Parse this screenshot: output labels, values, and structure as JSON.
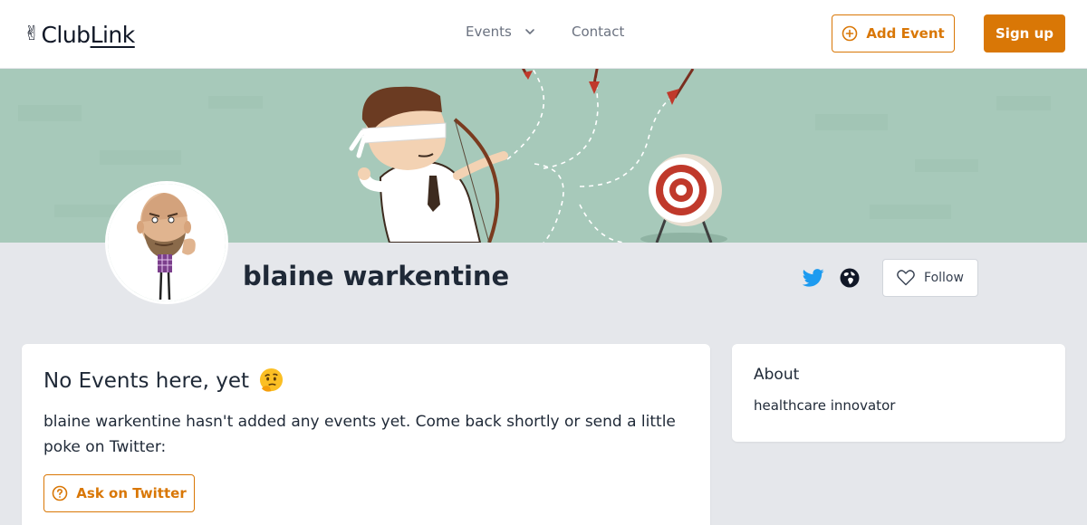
{
  "header": {
    "logo_hand_icon": "victory-hand-emoji",
    "logo_club": "Club",
    "logo_link": "Link",
    "nav": {
      "events_label": "Events",
      "contact_label": "Contact"
    },
    "add_event_label": "Add Event",
    "sign_up_label": "Sign up"
  },
  "profile": {
    "name": "blaine warkentine",
    "follow_label": "Follow",
    "social_icons": [
      "twitter-icon",
      "globe-icon"
    ]
  },
  "events_card": {
    "title": "No Events here, yet",
    "title_emoji": "thinking-face-emoji",
    "message": "blaine warkentine hasn't added any events yet. Come back shortly or send a little poke on Twitter:",
    "ask_button_label": "Ask on Twitter"
  },
  "about_card": {
    "title": "About",
    "text": "healthcare innovator"
  },
  "colors": {
    "accent": "#d97706",
    "banner": "#a7c9ba",
    "page_background": "#e5e7eb",
    "twitter": "#1d9bf0"
  }
}
